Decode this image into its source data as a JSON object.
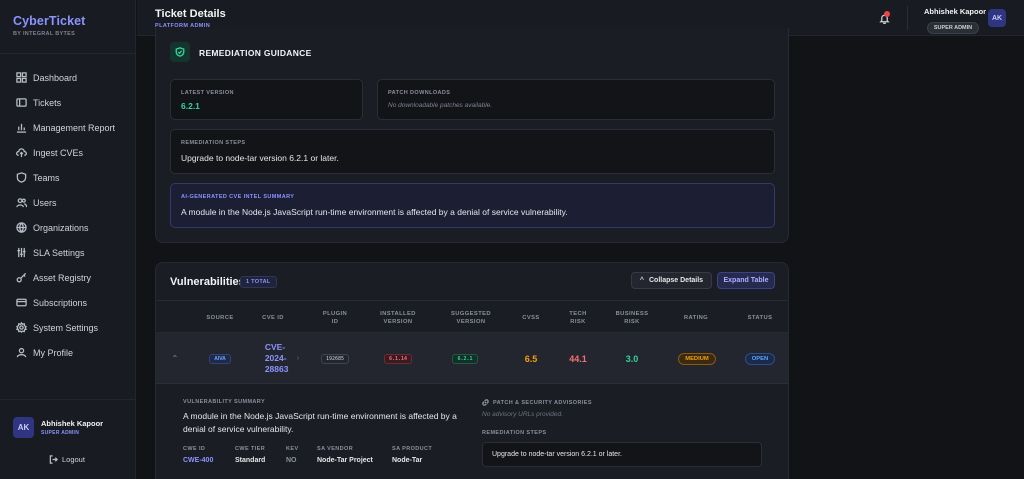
{
  "brand": {
    "title": "CyberTicket",
    "subtitle": "BY INTEGRAL BYTES"
  },
  "nav": [
    {
      "label": "Dashboard",
      "icon": "dashboard-icon"
    },
    {
      "label": "Tickets",
      "icon": "ticket-icon"
    },
    {
      "label": "Management Report",
      "icon": "report-icon"
    },
    {
      "label": "Ingest CVEs",
      "icon": "cloud-upload-icon"
    },
    {
      "label": "Teams",
      "icon": "shield-icon"
    },
    {
      "label": "Users",
      "icon": "users-icon"
    },
    {
      "label": "Organizations",
      "icon": "organization-icon"
    },
    {
      "label": "SLA Settings",
      "icon": "sliders-icon"
    },
    {
      "label": "Asset Registry",
      "icon": "key-icon"
    },
    {
      "label": "Subscriptions",
      "icon": "credit-card-icon"
    },
    {
      "label": "System Settings",
      "icon": "gear-icon"
    },
    {
      "label": "My Profile",
      "icon": "user-icon"
    }
  ],
  "sidebar_user": {
    "initials": "AK",
    "name": "Abhishek Kapoor",
    "role": "SUPER ADMIN",
    "logout": "Logout"
  },
  "header": {
    "title": "Ticket Details",
    "subtitle": "PLATFORM ADMIN",
    "user_name": "Abhishek Kapoor",
    "user_role": "SUPER ADMIN",
    "initials": "AK"
  },
  "remediation": {
    "title": "REMEDIATION GUIDANCE",
    "latest_label": "LATEST VERSION",
    "latest_value": "6.2.1",
    "patch_label": "PATCH DOWNLOADS",
    "patch_value": "No downloadable patches available.",
    "steps_label": "REMEDIATION STEPS",
    "steps_value": "Upgrade to node-tar version 6.2.1 or later.",
    "ai_label": "AI-GENERATED CVE INTEL SUMMARY",
    "ai_value": "A module in the Node.js JavaScript run-time environment is affected by a denial of service vulnerability."
  },
  "vulnerabilities": {
    "title": "Vulnerabilities",
    "count": "1 TOTAL",
    "collapse_label": "Collapse Details",
    "expand_label": "Expand Table",
    "columns": {
      "source": "SOURCE",
      "cve_id": "CVE ID",
      "plugin_id": "PLUGIN ID",
      "installed": "INSTALLED VERSION",
      "suggested": "SUGGESTED VERSION",
      "cvss": "CVSS",
      "tech_risk": "TECH RISK",
      "business_risk": "BUSINESS RISK",
      "rating": "RATING",
      "status": "STATUS"
    },
    "row": {
      "source": "AIVA",
      "cve_id": "CVE-2024-28863",
      "plugin_id": "192685",
      "installed": "6.1.14",
      "suggested": "6.2.1",
      "cvss": "6.5",
      "tech_risk": "44.1",
      "business_risk": "3.0",
      "rating": "MEDIUM",
      "status": "OPEN"
    },
    "detail": {
      "summary_label": "VULNERABILITY SUMMARY",
      "summary": "A module in the Node.js JavaScript run-time environment is affected by a denial of service vulnerability.",
      "cwe_id_label": "CWE ID",
      "cwe_id": "CWE-400",
      "cwe_tier_label": "CWE TIER",
      "cwe_tier": "Standard",
      "kev_label": "KEV",
      "kev": "NO",
      "sa_vendor_label": "SA VENDOR",
      "sa_vendor": "Node-Tar Project",
      "sa_product_label": "SA PRODUCT",
      "sa_product": "Node-Tar",
      "advisories_label": "PATCH & SECURITY ADVISORIES",
      "advisories_value": "No advisory URLs provided.",
      "steps_label": "REMEDIATION STEPS",
      "steps_value": "Upgrade to node-tar version 6.2.1 or later."
    }
  },
  "colors": {
    "accent": "#8b93ff",
    "success": "#34d399",
    "danger": "#f87171",
    "warning": "#f59e0b",
    "info": "#60a5fa"
  }
}
